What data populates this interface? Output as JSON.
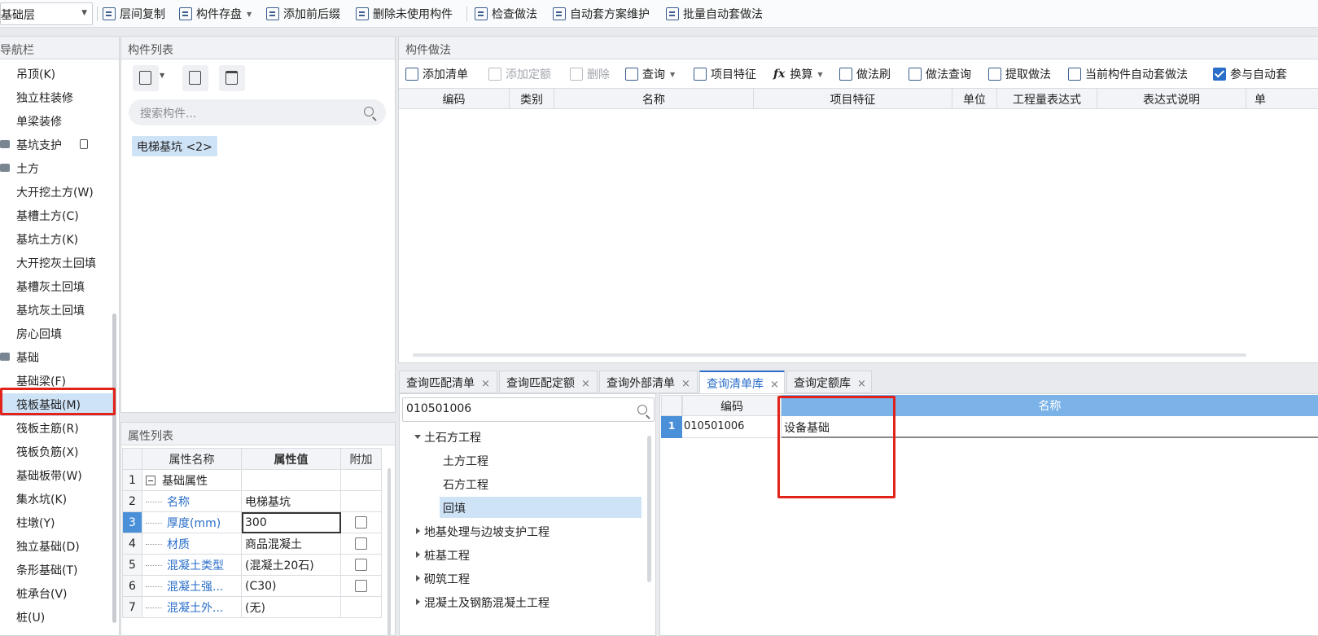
{
  "toolbar": {
    "floor_select": "基础层",
    "buttons": [
      "层间复制",
      "构件存盘",
      "添加前后缀",
      "删除未使用构件",
      "检查做法",
      "自动套方案维护",
      "批量自动套做法"
    ]
  },
  "nav": {
    "title": "导航栏",
    "items": [
      "吊顶(K)",
      "独立柱装修",
      "单梁装修",
      "基坑支护",
      "土方",
      "大开挖土方(W)",
      "基槽土方(C)",
      "基坑土方(K)",
      "大开挖灰土回填",
      "基槽灰土回填",
      "基坑灰土回填",
      "房心回填",
      "基础",
      "基础梁(F)",
      "筏板基础(M)",
      "筏板主筋(R)",
      "筏板负筋(X)",
      "基础板带(W)",
      "集水坑(K)",
      "柱墩(Y)",
      "独立基础(D)",
      "条形基础(T)",
      "桩承台(V)",
      "桩(U)"
    ],
    "selected": "筏板基础(M)"
  },
  "components": {
    "title": "构件列表",
    "search_placeholder": "搜索构件...",
    "tag": "电梯基坑 <2>"
  },
  "attributes": {
    "title": "属性列表",
    "headers": [
      "属性名称",
      "属性值",
      "附加"
    ],
    "rows": [
      {
        "num": "1",
        "name": "基础属性",
        "value": ""
      },
      {
        "num": "2",
        "name": "名称",
        "value": "电梯基坑"
      },
      {
        "num": "3",
        "name": "厚度(mm)",
        "value": "300"
      },
      {
        "num": "4",
        "name": "材质",
        "value": "商品混凝土"
      },
      {
        "num": "5",
        "name": "混凝土类型",
        "value": "(混凝土20石)"
      },
      {
        "num": "6",
        "name": "混凝土强...",
        "value": "(C30)"
      },
      {
        "num": "7",
        "name": "混凝土外...",
        "value": "(无)"
      }
    ]
  },
  "methods": {
    "title": "构件做法",
    "toolbar": [
      "添加清单",
      "添加定额",
      "删除",
      "查询",
      "项目特征",
      "换算",
      "做法刷",
      "做法查询",
      "提取做法",
      "当前构件自动套做法",
      "参与自动套"
    ],
    "fx_label": "fx",
    "columns": [
      "编码",
      "类别",
      "名称",
      "项目特征",
      "单位",
      "工程量表达式",
      "表达式说明",
      "单"
    ]
  },
  "query": {
    "tabs": [
      "查询匹配清单",
      "查询匹配定额",
      "查询外部清单",
      "查询清单库",
      "查询定额库"
    ],
    "active_tab": "查询清单库",
    "close_label": "×",
    "search_value": "010501006",
    "tree": [
      "土石方工程",
      "土方工程",
      "石方工程",
      "回填",
      "地基处理与边坡支护工程",
      "桩基工程",
      "砌筑工程",
      "混凝土及钢筋混凝土工程"
    ],
    "result_headers": [
      "编码",
      "名称"
    ],
    "result_row": {
      "num": "1",
      "code": "010501006",
      "name": "设备基础"
    }
  },
  "colors": {
    "accent": "#2a6ec9",
    "highlight_red": "#e2231a",
    "selection": "#cfe3f7"
  }
}
